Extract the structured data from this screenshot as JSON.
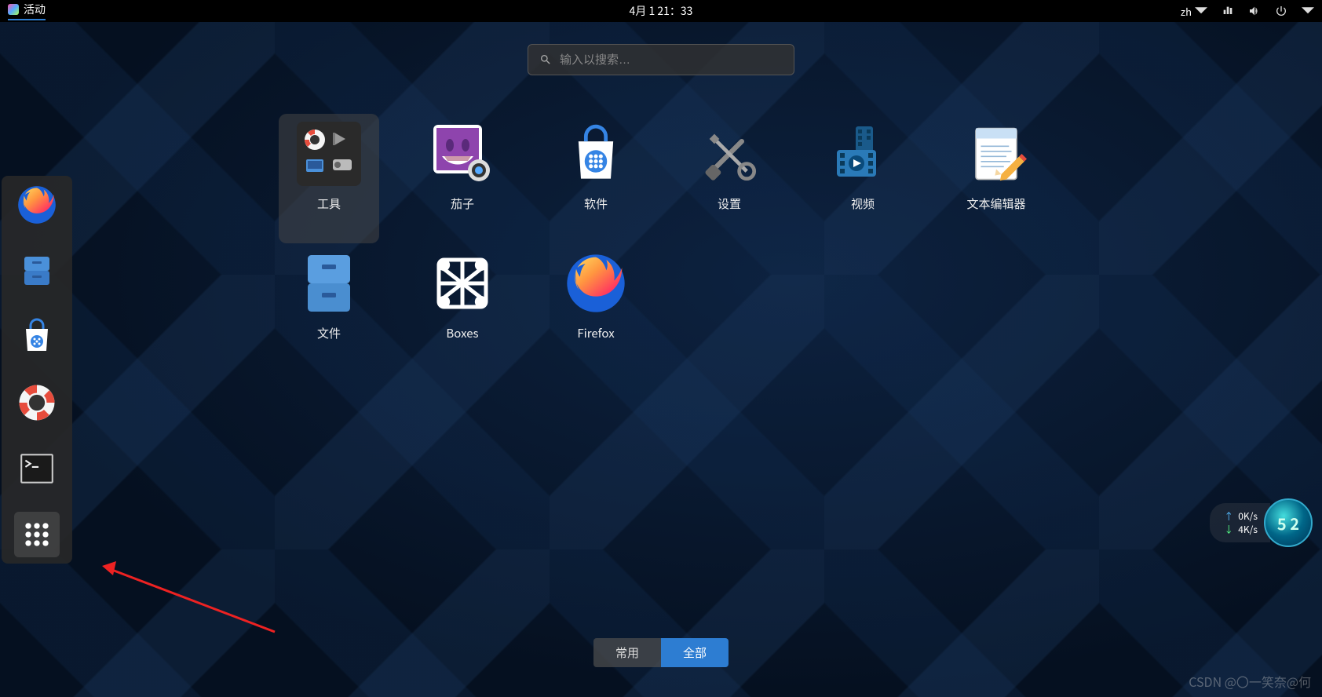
{
  "topbar": {
    "activities": "活动",
    "datetime": "4月 1 21：33",
    "lang": "zh"
  },
  "search": {
    "placeholder": "输入以搜索…"
  },
  "apps": [
    {
      "label": "工具"
    },
    {
      "label": "茄子"
    },
    {
      "label": "软件"
    },
    {
      "label": "设置"
    },
    {
      "label": "视频"
    },
    {
      "label": "文本编辑器"
    },
    {
      "label": "文件"
    },
    {
      "label": "Boxes"
    },
    {
      "label": "Firefox"
    }
  ],
  "toggle": {
    "frequent": "常用",
    "all": "全部"
  },
  "network": {
    "up": "0K/s",
    "down": "4K/s",
    "globe": "5 2"
  },
  "watermark": "CSDN @〇一笑奈@何"
}
